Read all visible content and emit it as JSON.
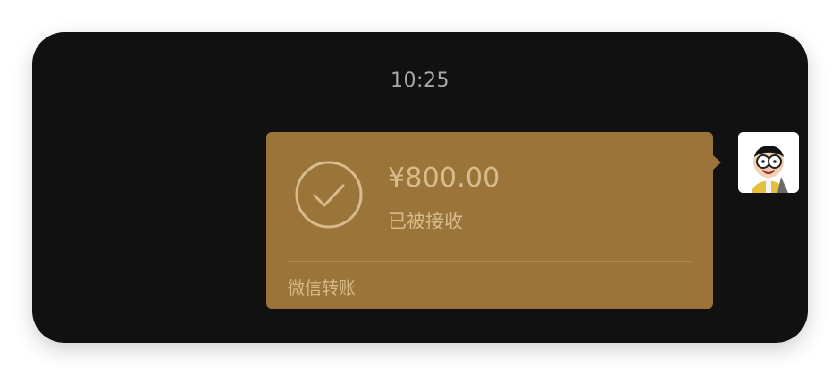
{
  "chat": {
    "timestamp": "10:25"
  },
  "transfer": {
    "amount": "¥800.00",
    "status": "已被接收",
    "footer": "微信转账",
    "colors": {
      "card_bg": "#9a7439",
      "text": "#d7bb8c"
    },
    "icon": "check-circle-icon"
  },
  "sender": {
    "avatar_icon": "cartoon-avatar"
  }
}
